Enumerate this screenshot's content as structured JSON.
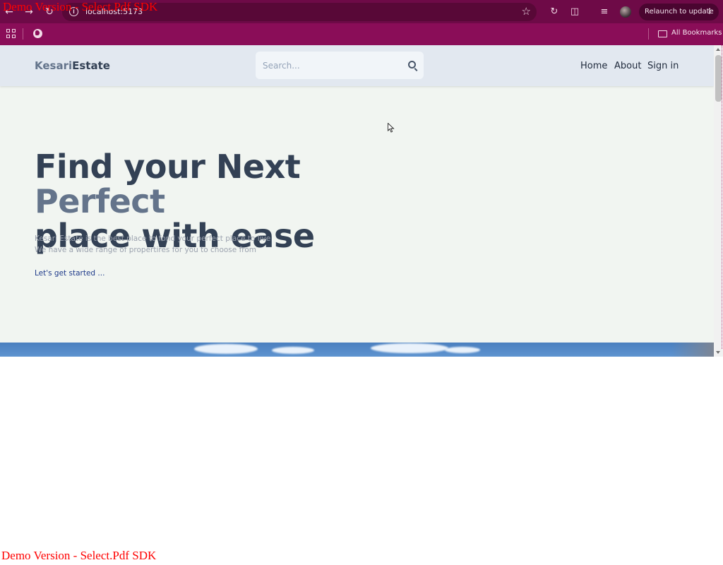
{
  "browser": {
    "url": "localhost:5173",
    "relaunch_label": "Relaunch to update",
    "bookmarks_label": "All Bookmarks",
    "colors": {
      "titlebar": "#6e0a47",
      "bookmarks_bar": "#8a0d58"
    }
  },
  "site": {
    "logo_part1": "Kesari",
    "logo_part2": "Estate",
    "search_placeholder": "Search...",
    "nav": {
      "home": "Home",
      "about": "About",
      "signin": "Sign in"
    },
    "hero": {
      "title_part1": "Find your Next ",
      "title_accent": "Perfect",
      "title_part2": "place with ease",
      "subtitle_line1": "Kesari Estate is the best place to fond your perfect place to live",
      "subtitle_line2": "We have a wide range of propertires for you to choose from",
      "cta": "Let's get started ..."
    },
    "colors": {
      "header_bg": "#e2e8f0",
      "page_bg": "#f1f5f1",
      "title": "#334155",
      "accent": "#64748b"
    }
  },
  "watermark": {
    "top": "Demo Version - Select.Pdf SDK",
    "bottom": "Demo Version - Select.Pdf SDK"
  }
}
